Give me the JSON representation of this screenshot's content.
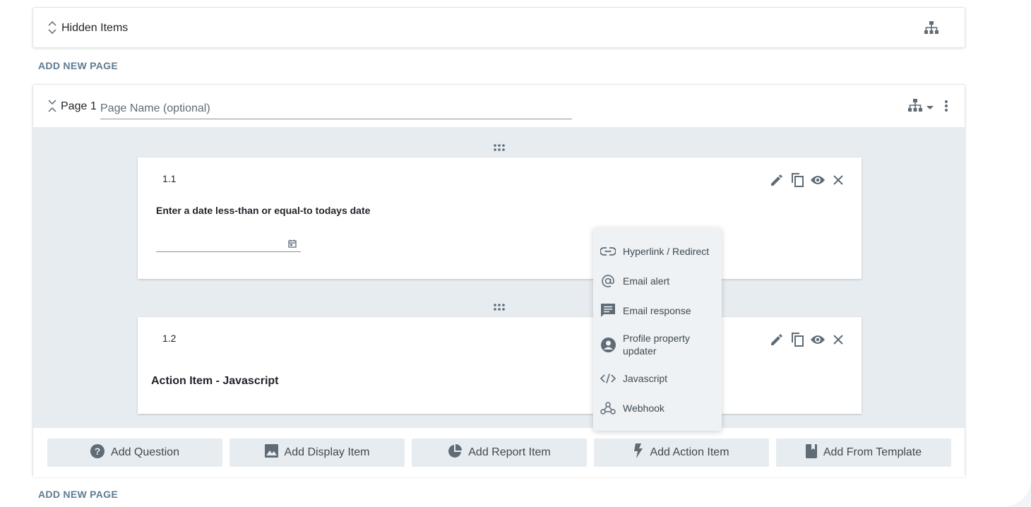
{
  "hidden_items": {
    "title": "Hidden Items"
  },
  "add_new_page_label": "ADD NEW PAGE",
  "page": {
    "label": "Page 1",
    "name_placeholder": "Page Name (optional)",
    "name_value": ""
  },
  "items": [
    {
      "number": "1.1",
      "question": "Enter a date less-than or equal-to todays date",
      "date_value": ""
    },
    {
      "number": "1.2",
      "title": "Action Item - Javascript"
    }
  ],
  "footer_buttons": [
    {
      "label": "Add Question",
      "icon": "help-circle-icon"
    },
    {
      "label": "Add Display Item",
      "icon": "image-icon"
    },
    {
      "label": "Add Report Item",
      "icon": "pie-chart-icon"
    },
    {
      "label": "Add Action Item",
      "icon": "lightning-icon"
    },
    {
      "label": "Add From Template",
      "icon": "book-icon"
    }
  ],
  "action_menu": [
    {
      "label": "Hyperlink / Redirect",
      "icon": "link-icon"
    },
    {
      "label": "Email alert",
      "icon": "at-sign-icon"
    },
    {
      "label": "Email response",
      "icon": "message-icon"
    },
    {
      "label": "Profile property updater",
      "icon": "account-circle-icon"
    },
    {
      "label": "Javascript",
      "icon": "code-icon"
    },
    {
      "label": "Webhook",
      "icon": "webhook-icon"
    }
  ],
  "colors": {
    "accent_text": "#5f7b91",
    "icon_gray": "#5f6b75",
    "canvas_bg": "#e7ecf0",
    "menu_bg": "#eef2f5"
  }
}
